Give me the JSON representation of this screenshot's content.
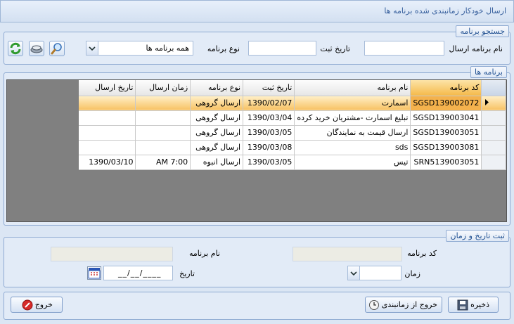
{
  "window": {
    "title": "ارسال خودکار زمانبندی شده برنامه ها"
  },
  "search": {
    "legend": "جستجو برنامه",
    "name_label": "نام برنامه ارسال",
    "name_value": "",
    "date_label": "تاریخ ثبت",
    "date_value": "",
    "type_label": "نوع برنامه",
    "type_selected": "همه برنامه ها",
    "icons": [
      "refresh-icon",
      "clear-icon",
      "search-icon"
    ]
  },
  "programs": {
    "legend": "برنامه ها",
    "columns": [
      "کد برنامه",
      "نام برنامه",
      "تاریخ ثبت",
      "نوع برنامه",
      "زمان ارسال",
      "تاریخ ارسال"
    ],
    "rows": [
      {
        "code": "SGSD139002072",
        "name": "اسمارت",
        "reg_date": "1390/02/07",
        "type": "ارسال گروهی",
        "send_time": "",
        "send_date": ""
      },
      {
        "code": "SGSD139003041",
        "name": "تبلیغ اسمارت -مشتریان خرید کرده",
        "reg_date": "1390/03/04",
        "type": "ارسال گروهی",
        "send_time": "",
        "send_date": ""
      },
      {
        "code": "SGSD139003051",
        "name": "ارسال قیمت به نمایندگان",
        "reg_date": "1390/03/05",
        "type": "ارسال گروهی",
        "send_time": "",
        "send_date": ""
      },
      {
        "code": "SGSD139003081",
        "name": "sds",
        "reg_date": "1390/03/08",
        "type": "ارسال گروهی",
        "send_time": "",
        "send_date": ""
      },
      {
        "code": "SRN5139003051",
        "name": "تیس",
        "reg_date": "1390/03/05",
        "type": "ارسال انبوه",
        "send_time": "AM 7:00",
        "send_date": "1390/03/10"
      }
    ]
  },
  "schedule": {
    "legend": "ثبت تاریخ و زمان",
    "code_label": "کد برنامه",
    "code_value": "",
    "name_label": "نام برنامه",
    "name_value": "",
    "time_label": "زمان",
    "time_value": "",
    "date_label": "تاریخ",
    "date_value": "__/__/____"
  },
  "footer": {
    "save_label": "ذخیره",
    "unschedule_label": "خروج از زمانبندی",
    "exit_label": "خروج"
  },
  "colors": {
    "selected_row": "#f7c263",
    "accent": "#1f4f91"
  }
}
